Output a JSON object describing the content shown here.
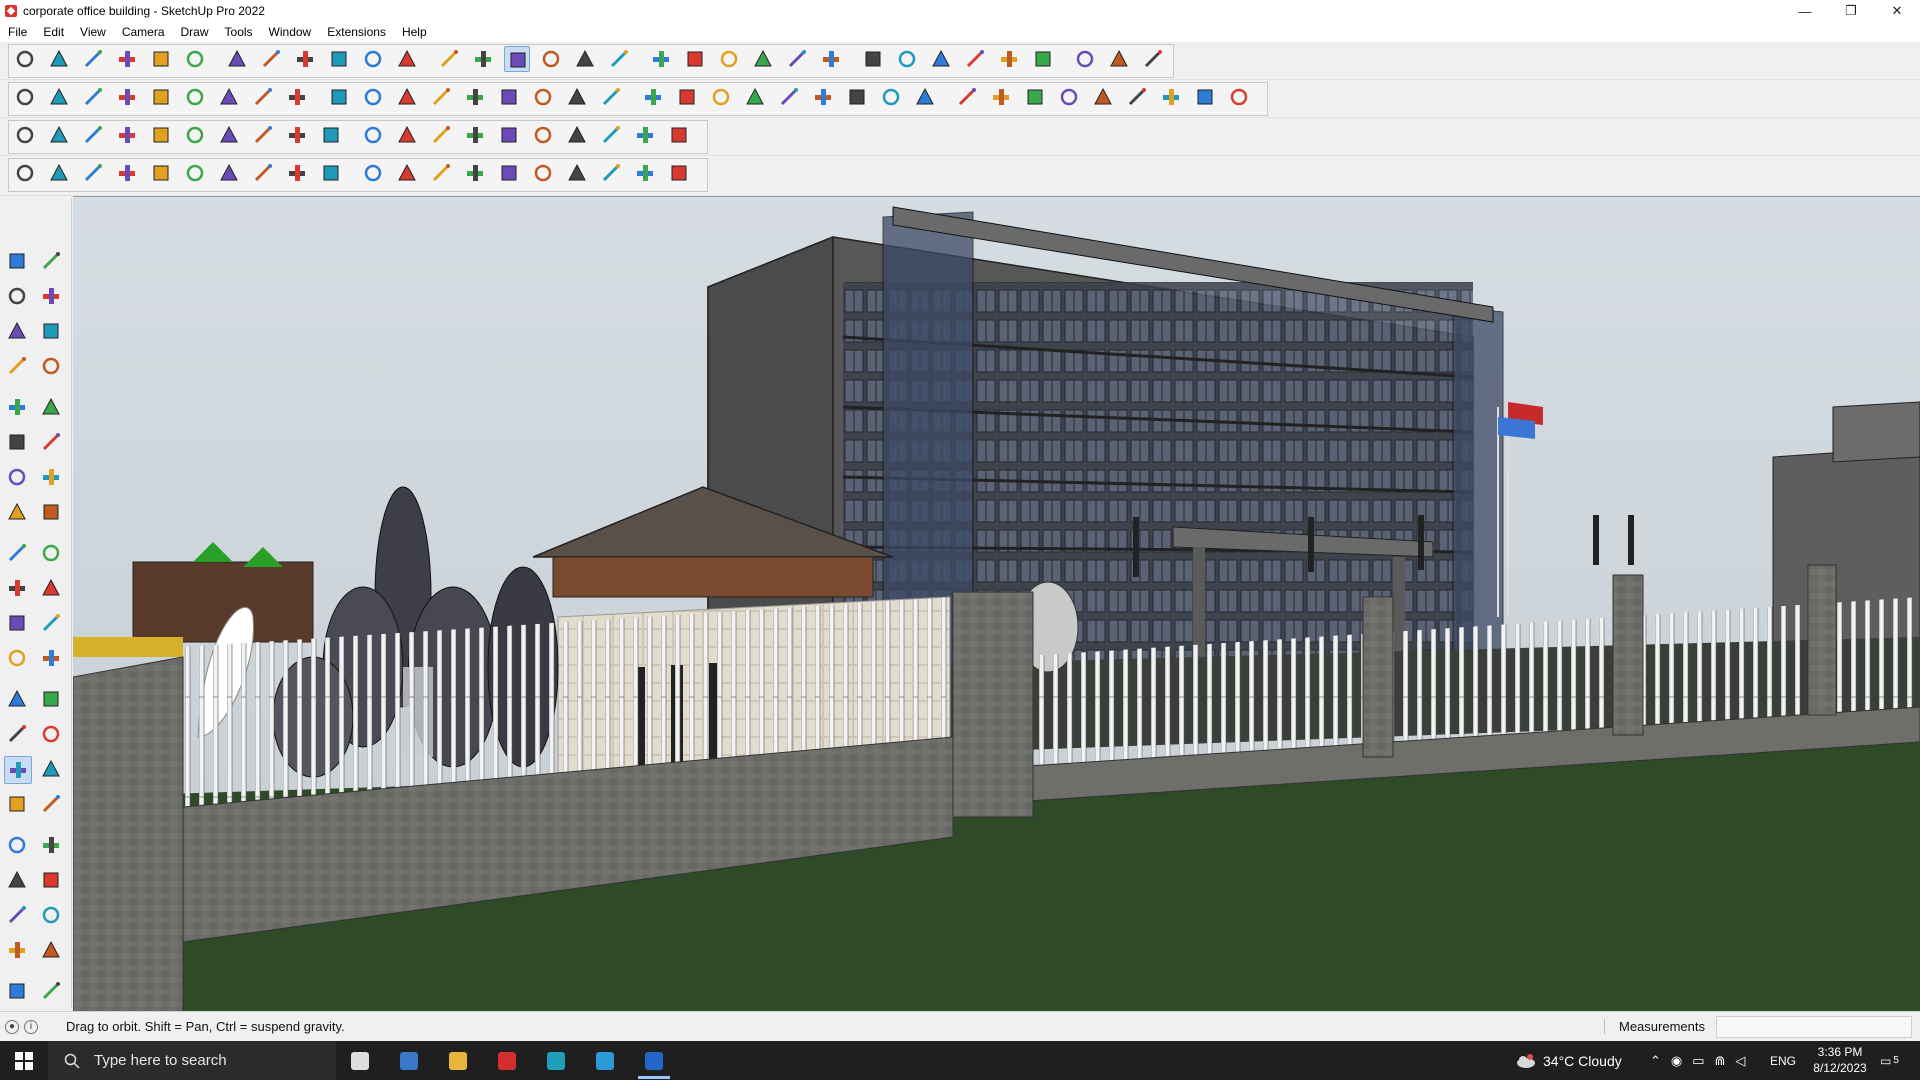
{
  "window": {
    "title": "corporate office building - SketchUp Pro 2022",
    "controls": {
      "minimize": "—",
      "maximize": "❐",
      "close": "✕"
    }
  },
  "menubar": {
    "items": [
      "File",
      "Edit",
      "View",
      "Camera",
      "Draw",
      "Tools",
      "Window",
      "Extensions",
      "Help"
    ]
  },
  "toolbars": {
    "active_tool": "orbit",
    "row1_icons": [
      "zoom-extents-icon",
      "select-icon",
      "eraser-icon",
      "line-icon",
      "arc-icon",
      "rectangle-icon",
      "push-pull-icon",
      "follow-me-icon",
      "move-icon",
      "rotate-icon",
      "scale-icon",
      "tape-measure-icon",
      "text-icon",
      "paint-bucket-icon",
      "orbit-icon",
      "pan-icon",
      "zoom-icon",
      "zoom-window-icon",
      "styles-icon",
      "shadows-icon",
      "fog-icon",
      "section-icon",
      "user-account-icon",
      "warehouse-icon",
      "extension-warehouse-icon",
      "layout-icon",
      "upload-icon",
      "download-icon",
      "dimension-icon",
      "sandbox-icon",
      "undo-icon",
      "redo-icon",
      "trimble-icon"
    ],
    "row2_icons": [
      "component-icon",
      "group-icon",
      "solid-icon",
      "outer-shell-icon",
      "intersect-icon",
      "union-icon",
      "subtract-icon",
      "trim-icon",
      "split-icon",
      "soften-icon",
      "section-plane-icon",
      "section-fill-icon",
      "section-cut-icon",
      "iso-icon",
      "top-icon",
      "front-icon",
      "right-icon",
      "back-icon",
      "left-icon",
      "house-icon",
      "perspective-icon",
      "xray-icon",
      "back-edges-icon",
      "wireframe-icon",
      "hidden-line-icon",
      "shaded-icon",
      "textured-icon",
      "monochrome-icon",
      "hand-icon",
      "circle-icon",
      "polygon-icon",
      "arc2-icon",
      "pie-icon",
      "freehand-icon",
      "offset-icon",
      "paint-icon"
    ],
    "row3_icons": [
      "plane-icon",
      "layer-icon",
      "material-icon",
      "shape-icon",
      "gradient-icon",
      "rotate-copy-icon",
      "rectangle-red-icon",
      "stairs-icon",
      "roof-icon",
      "wall-icon",
      "window-icon",
      "door-icon",
      "array-icon",
      "grid-icon",
      "mirror-icon",
      "align-icon",
      "split-face-icon",
      "cone-icon",
      "pyramid-icon",
      "extrude-icon"
    ],
    "row4_icons": [
      "draw-icon",
      "bezier-icon",
      "spline-icon",
      "fillet-icon",
      "chamfer-icon",
      "sphere-icon",
      "torus-icon",
      "curve-icon",
      "loft-icon",
      "sweep-icon",
      "shell-icon",
      "taper-icon",
      "twist-icon",
      "bend-icon",
      "stretch-icon",
      "flex-icon",
      "dome-icon",
      "vault-icon",
      "lattice-icon",
      "texture-icon"
    ]
  },
  "left_palette": {
    "icons": [
      "select-icon",
      "orbit-icon",
      "paint-bucket-icon",
      "eraser-icon",
      "component-icon",
      "tag-icon",
      "line-icon",
      "freehand-icon",
      "rectangle-icon",
      "rotated-rectangle-icon",
      "circle-icon",
      "polygon-icon",
      "arc-icon",
      "two-point-arc-icon",
      "three-point-arc-icon",
      "pie-icon",
      "move-icon",
      "push-pull-icon",
      "rotate-icon",
      "follow-me-icon",
      "scale-icon",
      "offset-icon",
      "tape-measure-icon",
      "dimension-icon",
      "protractor-icon",
      "text-icon",
      "axes-icon",
      "three-d-text-icon",
      "orbit-icon",
      "pan-icon",
      "zoom-icon",
      "zoom-window-icon",
      "zoom-extents-icon",
      "previous-view-icon",
      "position-camera-icon",
      "look-around-icon",
      "walk-icon",
      "section-plane-icon",
      "styles-icon",
      "shadows-icon",
      "layers-icon",
      "fog-icon"
    ]
  },
  "status": {
    "message": "Drag to orbit. Shift = Pan, Ctrl = suspend gravity.",
    "measurements_label": "Measurements",
    "measurements_value": ""
  },
  "taskbar": {
    "search_placeholder": "Type here to search",
    "weather": "34°C  Cloudy",
    "language": "ENG",
    "time": "3:36 PM",
    "date": "8/12/2023",
    "notification_count": "5",
    "apps": [
      "task-view-icon",
      "calculator-icon",
      "file-explorer-icon",
      "acrobat-icon",
      "sketchup-3-icon",
      "edge-icon",
      "sketchup-icon"
    ]
  },
  "colors": {
    "titlebar_bg": "#ffffff",
    "toolbar_bg": "#f0f0f0",
    "active_tool": "#c8dcf4",
    "sky": "#cfd6dc",
    "grass": "#2f4a27",
    "building": "#575757",
    "taskbar": "#1f1f1f"
  }
}
